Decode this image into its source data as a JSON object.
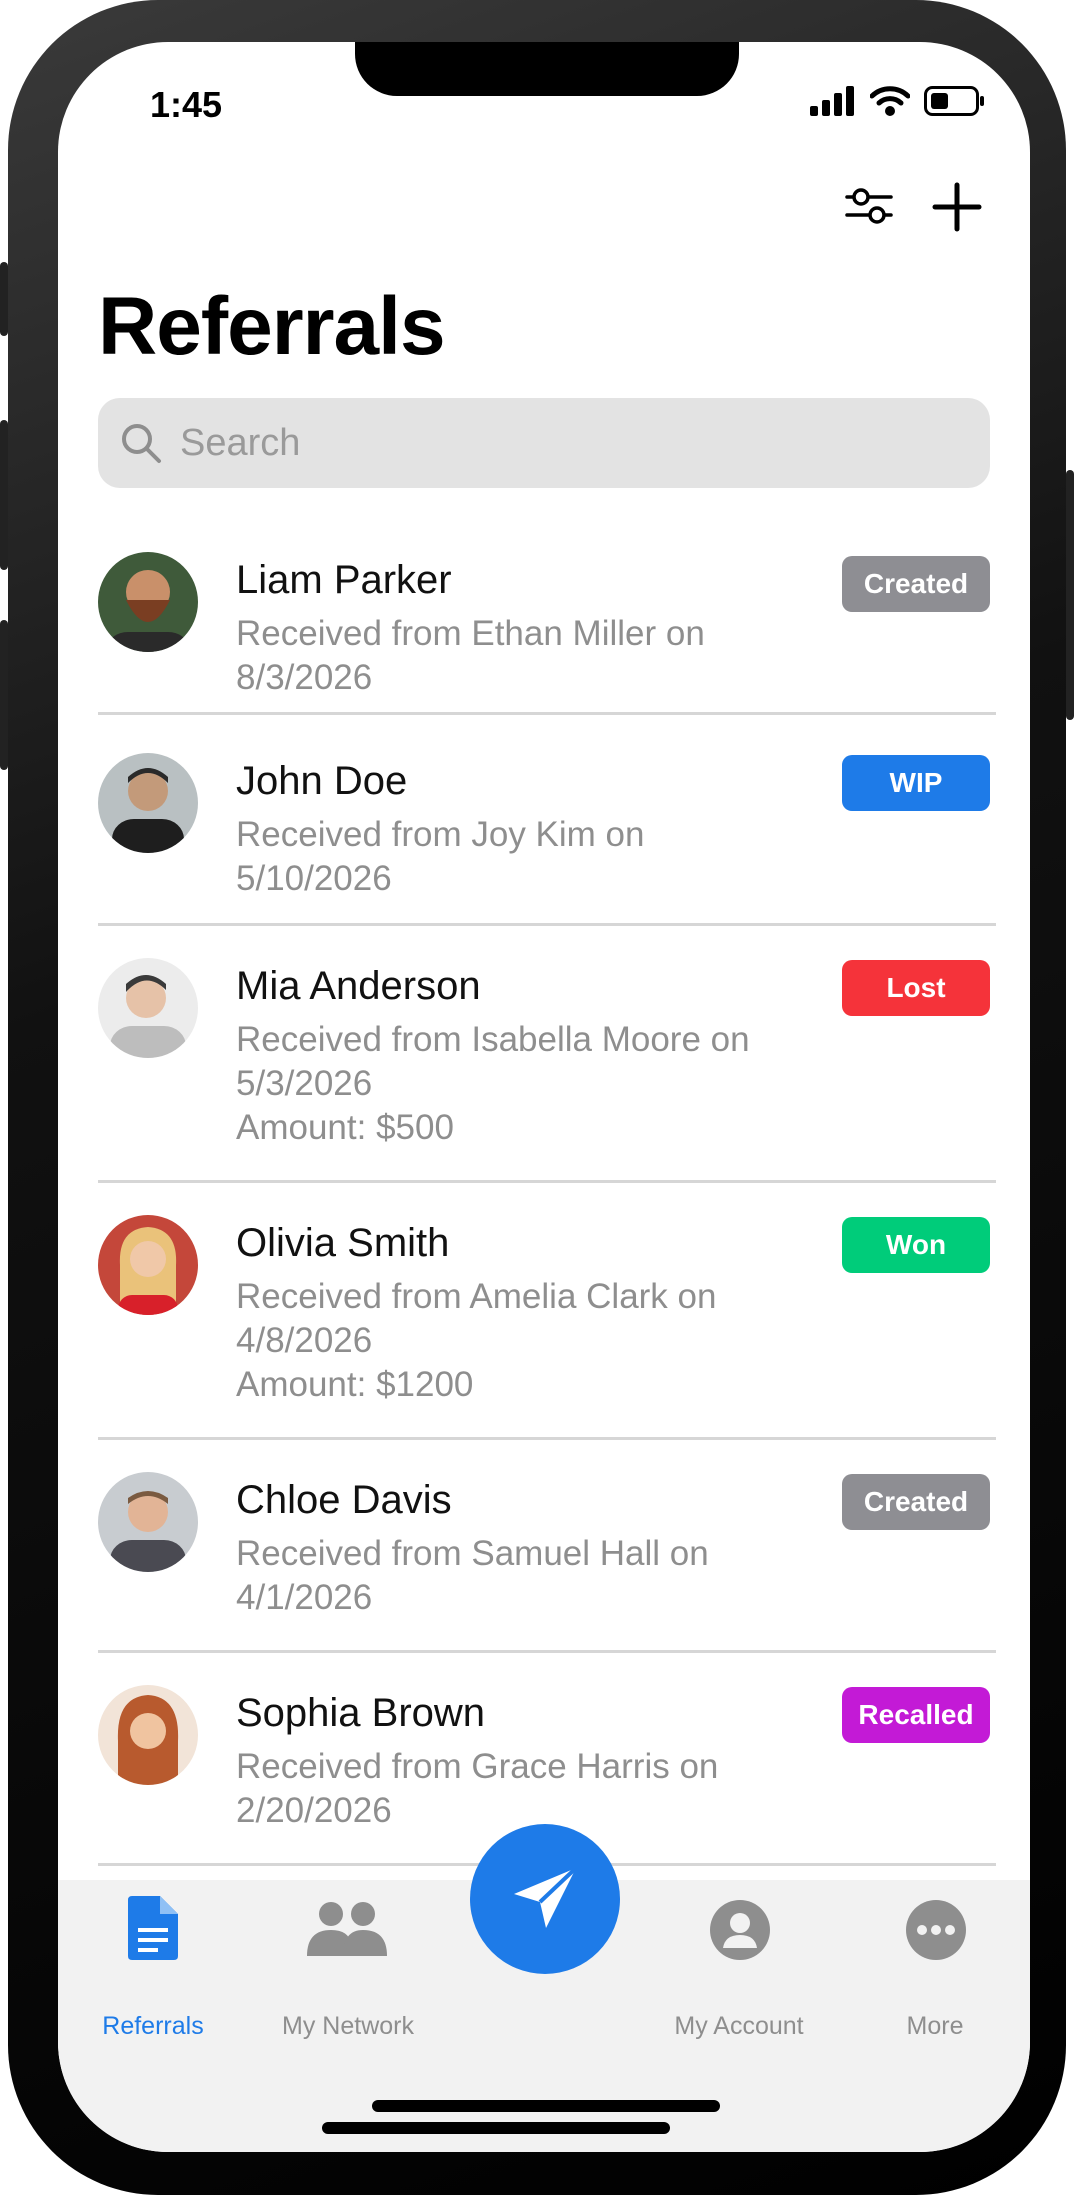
{
  "status": {
    "time": "1:45"
  },
  "header": {
    "title": "Referrals"
  },
  "search": {
    "placeholder": "Search"
  },
  "referrals": [
    {
      "name": "Liam Parker",
      "received": "Received from Ethan Miller on",
      "date": "8/3/2026",
      "amount": "",
      "status": "Created",
      "status_color": "#8e8e93",
      "avatar_color": "#8a5a3c"
    },
    {
      "name": "John Doe",
      "received": "Received from Joy Kim on",
      "date": "5/10/2026",
      "amount": "",
      "status": "WIP",
      "status_color": "#1e7be8",
      "avatar_color": "#4a4a4a"
    },
    {
      "name": "Mia Anderson",
      "received": "Received from Isabella Moore on",
      "date": "5/3/2026",
      "amount": "Amount: $500",
      "status": "Lost",
      "status_color": "#f5333a",
      "avatar_color": "#cfcfcf"
    },
    {
      "name": "Olivia Smith",
      "received": "Received from Amelia Clark on",
      "date": "4/8/2026",
      "amount": "Amount: $1200",
      "status": "Won",
      "status_color": "#00cc7a",
      "avatar_color": "#e8b070"
    },
    {
      "name": "Chloe Davis",
      "received": "Received from Samuel Hall on",
      "date": "4/1/2026",
      "amount": "",
      "status": "Created",
      "status_color": "#8e8e93",
      "avatar_color": "#8a9aa8"
    },
    {
      "name": "Sophia Brown",
      "received": "Received from Grace Harris on",
      "date": "2/20/2026",
      "amount": "",
      "status": "Recalled",
      "status_color": "#c31ad6",
      "avatar_color": "#c87a4a"
    }
  ],
  "tabbar": {
    "tabs": [
      {
        "label": "Referrals",
        "active": true
      },
      {
        "label": "My Network",
        "active": false
      },
      {
        "label": "My Account",
        "active": false
      },
      {
        "label": "More",
        "active": false
      }
    ],
    "active_color": "#1e7be8",
    "inactive_color": "#8e8e8e"
  },
  "icons": [
    "filter-icon",
    "plus-icon",
    "search-icon",
    "document-icon",
    "people-icon",
    "send-icon",
    "account-icon",
    "more-icon"
  ]
}
